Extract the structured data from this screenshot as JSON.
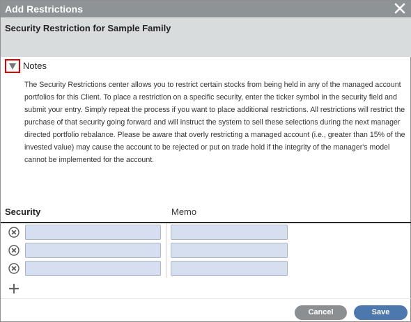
{
  "dialog": {
    "title": "Add Restrictions",
    "subtitle": "Security Restriction for Sample Family"
  },
  "notes": {
    "label": "Notes",
    "text": "The Security Restrictions center allows you to restrict certain stocks from being held in any of the managed account portfolios for this Client. To place a restriction on a specific security, enter the ticker symbol in the security field and submit your entry. Simply repeat the process if you want to place additional restrictions. All restrictions will restrict the purchase of that security going forward and will instruct the system to sell these selections during the next manager directed portfolio rebalance. Please be aware that overly restricting a managed account (i.e., greater than 15% of the invested value) may cause the account to be rejected or put on trade hold if the integrity of the manager's model cannot be implemented for the account."
  },
  "table": {
    "columns": {
      "security": "Security",
      "memo": "Memo"
    },
    "rows": [
      {
        "security": "",
        "memo": ""
      },
      {
        "security": "",
        "memo": ""
      },
      {
        "security": "",
        "memo": ""
      }
    ]
  },
  "buttons": {
    "cancel": "Cancel",
    "save": "Save"
  },
  "icons": {
    "close": "close-icon",
    "toggle": "triangle-down-icon",
    "remove": "remove-circle-icon",
    "add": "plus-icon"
  },
  "colors": {
    "title_bar": "#8e9396",
    "subheader": "#d9dcdd",
    "input_fill": "#d5dff0",
    "save": "#4d78ae",
    "cancel": "#8c8f92",
    "highlight": "#e00000"
  }
}
